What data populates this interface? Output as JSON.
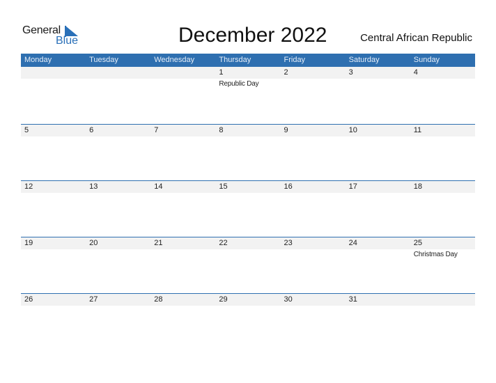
{
  "logo": {
    "word1": "General",
    "word2": "Blue"
  },
  "header": {
    "title": "December 2022",
    "country": "Central African Republic"
  },
  "colors": {
    "accent": "#2e6fb0",
    "date_band": "#f2f2f2"
  },
  "weekdays": [
    "Monday",
    "Tuesday",
    "Wednesday",
    "Thursday",
    "Friday",
    "Saturday",
    "Sunday"
  ],
  "weeks": [
    {
      "days": [
        {
          "num": "",
          "holiday": ""
        },
        {
          "num": "",
          "holiday": ""
        },
        {
          "num": "",
          "holiday": ""
        },
        {
          "num": "1",
          "holiday": "Republic Day"
        },
        {
          "num": "2",
          "holiday": ""
        },
        {
          "num": "3",
          "holiday": ""
        },
        {
          "num": "4",
          "holiday": ""
        }
      ]
    },
    {
      "days": [
        {
          "num": "5",
          "holiday": ""
        },
        {
          "num": "6",
          "holiday": ""
        },
        {
          "num": "7",
          "holiday": ""
        },
        {
          "num": "8",
          "holiday": ""
        },
        {
          "num": "9",
          "holiday": ""
        },
        {
          "num": "10",
          "holiday": ""
        },
        {
          "num": "11",
          "holiday": ""
        }
      ]
    },
    {
      "days": [
        {
          "num": "12",
          "holiday": ""
        },
        {
          "num": "13",
          "holiday": ""
        },
        {
          "num": "14",
          "holiday": ""
        },
        {
          "num": "15",
          "holiday": ""
        },
        {
          "num": "16",
          "holiday": ""
        },
        {
          "num": "17",
          "holiday": ""
        },
        {
          "num": "18",
          "holiday": ""
        }
      ]
    },
    {
      "days": [
        {
          "num": "19",
          "holiday": ""
        },
        {
          "num": "20",
          "holiday": ""
        },
        {
          "num": "21",
          "holiday": ""
        },
        {
          "num": "22",
          "holiday": ""
        },
        {
          "num": "23",
          "holiday": ""
        },
        {
          "num": "24",
          "holiday": ""
        },
        {
          "num": "25",
          "holiday": "Christmas Day"
        }
      ]
    },
    {
      "days": [
        {
          "num": "26",
          "holiday": ""
        },
        {
          "num": "27",
          "holiday": ""
        },
        {
          "num": "28",
          "holiday": ""
        },
        {
          "num": "29",
          "holiday": ""
        },
        {
          "num": "30",
          "holiday": ""
        },
        {
          "num": "31",
          "holiday": ""
        },
        {
          "num": "",
          "holiday": ""
        }
      ]
    }
  ]
}
